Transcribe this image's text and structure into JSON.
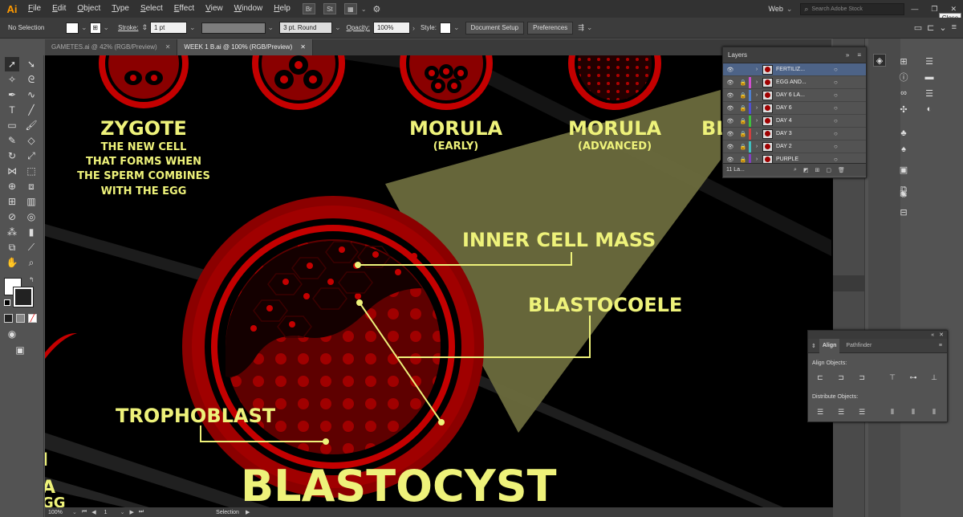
{
  "app": {
    "logo": "Ai"
  },
  "menu": [
    {
      "label": "File",
      "u": "F",
      "rest": "ile"
    },
    {
      "label": "Edit",
      "u": "E",
      "rest": "dit"
    },
    {
      "label": "Object",
      "u": "O",
      "rest": "bject"
    },
    {
      "label": "Type",
      "u": "T",
      "rest": "ype"
    },
    {
      "label": "Select",
      "u": "S",
      "rest": "elect"
    },
    {
      "label": "Effect",
      "u": "E",
      "rest": "ffect"
    },
    {
      "label": "View",
      "u": "V",
      "rest": "iew"
    },
    {
      "label": "Window",
      "u": "W",
      "rest": "indow"
    },
    {
      "label": "Help",
      "u": "H",
      "rest": "elp"
    }
  ],
  "menubar_right": {
    "bridge": "Br",
    "stock": "St",
    "workspace": "Web",
    "search_placeholder": "Search Adobe Stock"
  },
  "tooltip": "Close",
  "control": {
    "selection": "No Selection",
    "stroke_label": "Stroke:",
    "stroke_value": "1 pt",
    "brush": "3 pt. Round",
    "opacity_label": "Opacity:",
    "opacity_value": "100%",
    "style_label": "Style:",
    "doc_setup": "Document Setup",
    "preferences": "Preferences"
  },
  "tabs": [
    {
      "label": "GAMETES.ai @ 42% (RGB/Preview)"
    },
    {
      "label": "WEEK 1 B.ai @ 100% (RGB/Preview)"
    }
  ],
  "artwork": {
    "zygote_title": "ZYGOTE",
    "zygote_desc": [
      "THE NEW CELL",
      "THAT FORMS WHEN",
      "THE SPERM COMBINES",
      "WITH THE EGG"
    ],
    "morula1": "MORULA",
    "morula1_sub": "(EARLY)",
    "morula2": "MORULA",
    "morula2_sub": "(ADVANCED)",
    "partial": "BL",
    "inner_cell_mass": "INNER CELL MASS",
    "blastocoele": "BLASTOCOELE",
    "trophoblast": "TROPHOBLAST",
    "blastocyst": "BLASTOCYST",
    "edge_letter": "I",
    "edge_letters_2": "A",
    "edge_word": "GG"
  },
  "status": {
    "zoom": "100%",
    "page": "1",
    "mode": "Selection"
  },
  "layers": {
    "title": "Layers",
    "count": "11 La...",
    "rows": [
      {
        "name": "FERTILIZ...",
        "color": "#4d6387"
      },
      {
        "name": "EGG AND...",
        "color": "#d04fd0"
      },
      {
        "name": "DAY 6 LA...",
        "color": "#4f7fd0"
      },
      {
        "name": "DAY 6",
        "color": "#4f4fd0"
      },
      {
        "name": "DAY 4",
        "color": "#3fc03f"
      },
      {
        "name": "DAY 3",
        "color": "#d03f3f"
      },
      {
        "name": "DAY 2",
        "color": "#3fc0c0"
      },
      {
        "name": "PURPLE",
        "color": "#8040c0"
      }
    ]
  },
  "align": {
    "tab_align": "Align",
    "tab_pathfinder": "Pathfinder",
    "align_objects": "Align Objects:",
    "distribute_objects": "Distribute Objects:"
  },
  "colors": {
    "text": "#eef27a",
    "red": "#c40000",
    "dark_red": "#5e0000",
    "olive": "#6b6b3d"
  }
}
